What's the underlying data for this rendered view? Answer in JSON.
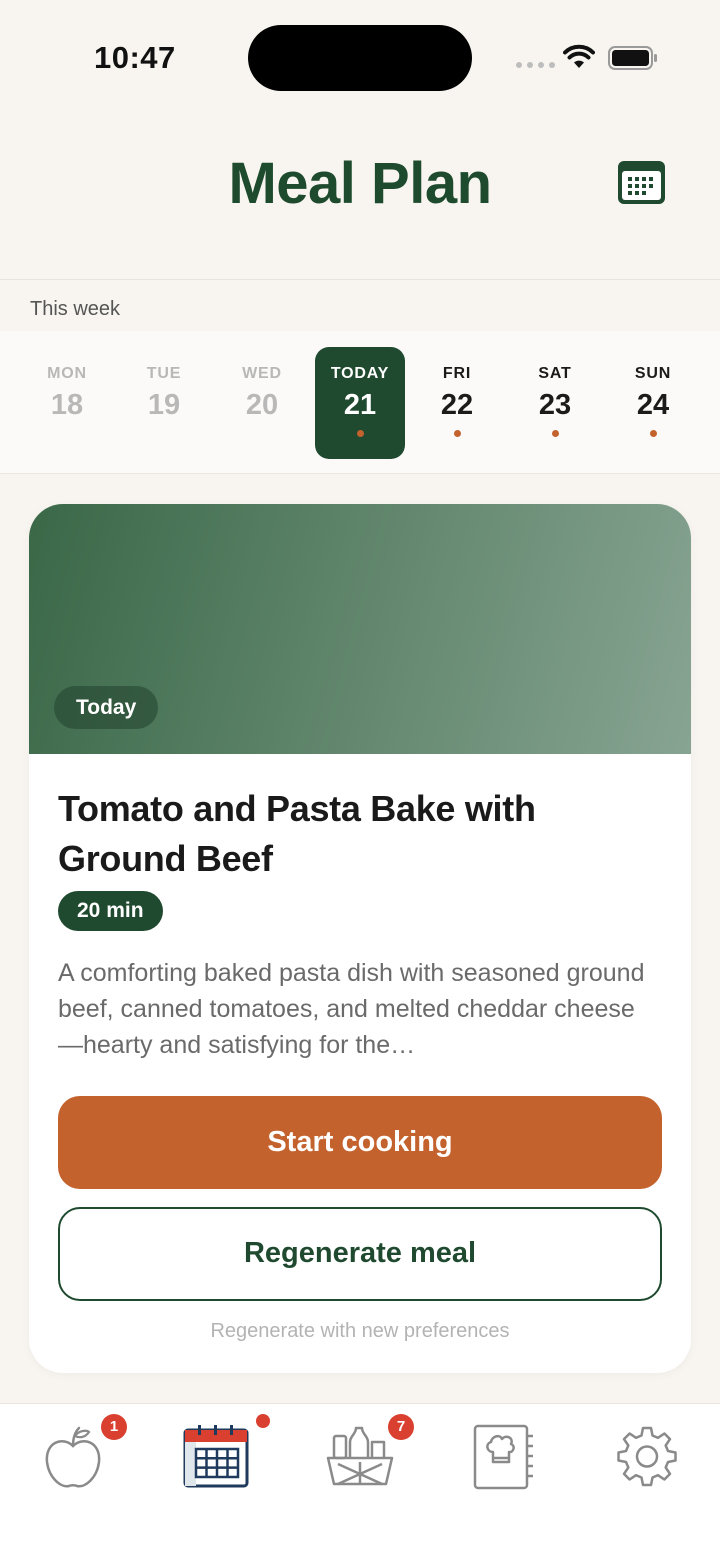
{
  "status_bar": {
    "time": "10:47"
  },
  "header": {
    "title": "Meal Plan"
  },
  "week": {
    "label": "This week",
    "days": [
      {
        "name": "MON",
        "num": "18",
        "state": "past"
      },
      {
        "name": "TUE",
        "num": "19",
        "state": "past"
      },
      {
        "name": "WED",
        "num": "20",
        "state": "past"
      },
      {
        "name": "TODAY",
        "num": "21",
        "state": "today"
      },
      {
        "name": "FRI",
        "num": "22",
        "state": "future"
      },
      {
        "name": "SAT",
        "num": "23",
        "state": "future"
      },
      {
        "name": "SUN",
        "num": "24",
        "state": "future"
      }
    ]
  },
  "meal": {
    "chip": "Today",
    "title": "Tomato and Pasta Bake with Ground Beef",
    "duration": "20 min",
    "description": "A comforting baked pasta dish with seasoned ground beef, canned tomatoes, and melted cheddar cheese—hearty and satisfying for the…",
    "start_label": "Start cooking",
    "regenerate_label": "Regenerate meal",
    "regenerate_hint": "Regenerate with new preferences"
  },
  "tabs": [
    {
      "icon": "apple-icon",
      "badge": "1"
    },
    {
      "icon": "calendar-icon",
      "badge": ""
    },
    {
      "icon": "grocery-basket-icon",
      "badge": "7"
    },
    {
      "icon": "recipe-book-icon",
      "badge": ""
    },
    {
      "icon": "gear-icon",
      "badge": ""
    }
  ],
  "colors": {
    "brand_green": "#204a2f",
    "accent_orange": "#c4622d",
    "badge_red": "#d94030",
    "background": "#f8f5f0"
  }
}
